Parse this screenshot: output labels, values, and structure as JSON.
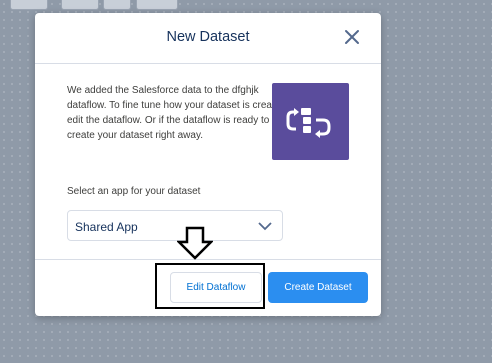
{
  "modal": {
    "title": "New Dataset",
    "description": "We added the Salesforce data to the dfghjk dataflow. To fine tune how your dataset is created, edit the dataflow. Or if the dataflow is ready to go, create your dataset right away.",
    "icon": "dataflow-icon",
    "select_label": "Select an app for your dataset",
    "select_value": "Shared App",
    "edit_button": "Edit Dataflow",
    "create_button": "Create Dataset"
  },
  "colors": {
    "icon_bg": "#5a4c9c",
    "primary_button": "#2b8ef0",
    "title_text": "#16325c"
  }
}
